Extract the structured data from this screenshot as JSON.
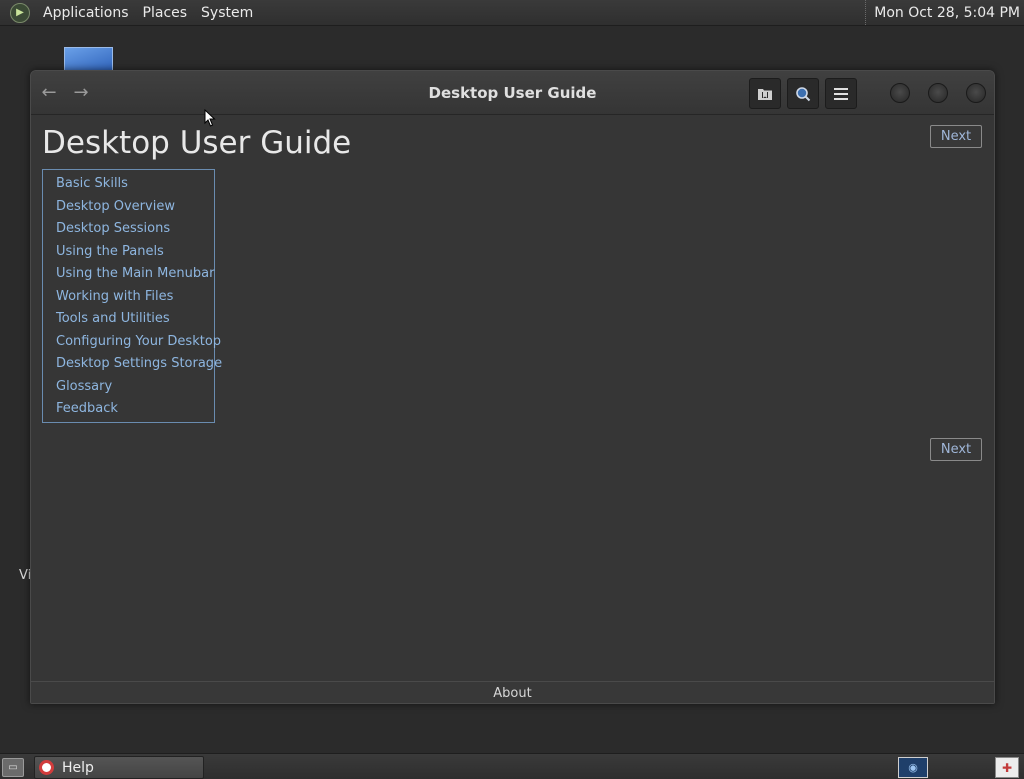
{
  "top_panel": {
    "menus": [
      "Applications",
      "Places",
      "System"
    ],
    "clock": "Mon Oct 28,  5:04 PM"
  },
  "desktop": {
    "partial_label": "Vi"
  },
  "window": {
    "title": "Desktop User Guide",
    "nav": {
      "back_icon": "←",
      "forward_icon": "→"
    },
    "toolbar": {
      "bookmarks_icon": "bookmark-icon",
      "search_icon": "search-icon",
      "menu_icon": "hamburger-menu-icon"
    }
  },
  "page": {
    "title": "Desktop User Guide",
    "next_label": "Next",
    "toc": [
      "Basic Skills",
      "Desktop Overview",
      "Desktop Sessions",
      "Using the Panels",
      "Using the Main Menubar",
      "Working with Files",
      "Tools and Utilities",
      "Configuring Your Desktop",
      "Desktop Settings Storage",
      "Glossary",
      "Feedback"
    ],
    "footer_link": "About"
  },
  "bottom_panel": {
    "task_label": "Help"
  },
  "colors": {
    "link": "#8eb6e0",
    "toc_border": "#6a8cb0",
    "background": "#363636"
  }
}
